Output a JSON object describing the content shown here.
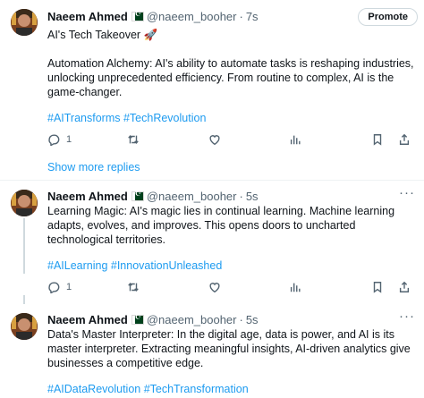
{
  "promote_label": "Promote",
  "show_more_replies": "Show more replies",
  "tweets": [
    {
      "name": "Naeem Ahmed",
      "handle": "@naeem_booher",
      "dot": "·",
      "time": "7s",
      "title": "AI's Tech Takeover 🚀",
      "body": "Automation Alchemy: AI's ability to automate tasks is reshaping industries, unlocking unprecedented efficiency. From routine to complex, AI is the game-changer.",
      "hashtags": "#AITransforms #TechRevolution",
      "reply_count": "1"
    },
    {
      "name": "Naeem Ahmed",
      "handle": "@naeem_booher",
      "dot": "·",
      "time": "5s",
      "body": "Learning Magic: AI's magic lies in continual learning. Machine learning adapts, evolves, and improves. This opens doors to uncharted technological territories.",
      "hashtags": "#AILearning #InnovationUnleashed",
      "reply_count": "1"
    },
    {
      "name": "Naeem Ahmed",
      "handle": "@naeem_booher",
      "dot": "·",
      "time": "5s",
      "body": "Data's Master Interpreter: In the digital age, data is power, and AI is its master interpreter. Extracting meaningful insights, AI-driven analytics give businesses a competitive edge.",
      "hashtags": "#AIDataRevolution #TechTransformation"
    }
  ],
  "icons": {
    "reply": "reply-icon",
    "repost": "repost-icon",
    "like": "like-icon",
    "views": "views-icon",
    "bookmark": "bookmark-icon",
    "share": "share-icon",
    "more": "more-icon",
    "flag": "pakistan-flag-icon"
  },
  "colors": {
    "link": "#1d9bf0",
    "secondary_text": "#536471",
    "primary_text": "#0f1419"
  }
}
